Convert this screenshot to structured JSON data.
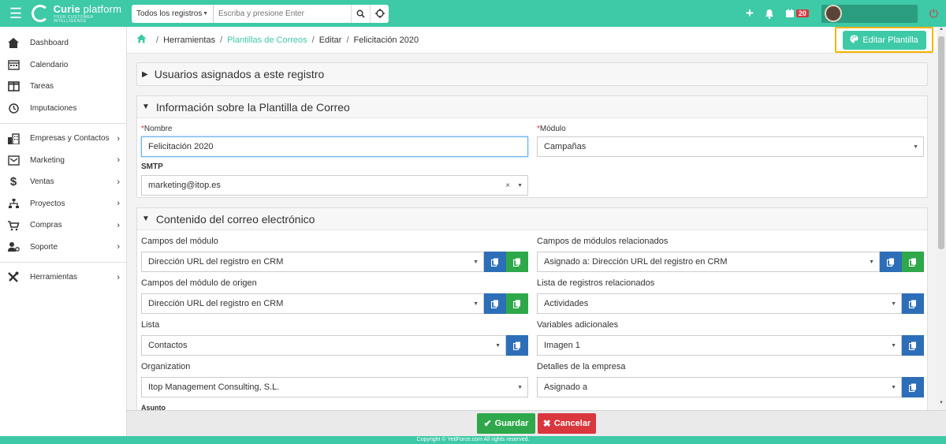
{
  "topbar": {
    "brand_name": "Curie",
    "brand_suffix": "platform",
    "brand_tagline": "YOUR CUSTOMER INTELLIGENCE",
    "search_scope": "Todos los registros",
    "search_placeholder": "Escriba y presione Enter",
    "calendar_badge": "20"
  },
  "sidebar": {
    "items": [
      {
        "label": "Dashboard"
      },
      {
        "label": "Calendario"
      },
      {
        "label": "Tareas"
      },
      {
        "label": "Imputaciones"
      },
      {
        "label": "Empresas y Contactos"
      },
      {
        "label": "Marketing"
      },
      {
        "label": "Ventas"
      },
      {
        "label": "Proyectos"
      },
      {
        "label": "Compras"
      },
      {
        "label": "Soporte"
      },
      {
        "label": "Herramientas"
      }
    ]
  },
  "breadcrumb": {
    "items": [
      "Herramientas",
      "Plantillas de Correos",
      "Editar",
      "Felicitación 2020"
    ]
  },
  "edit_template_label": "Editar Plantilla",
  "panels": {
    "users": {
      "title": "Usuarios asignados a este registro"
    },
    "info": {
      "title": "Información sobre la Plantilla de Correo",
      "name_label": "Nombre",
      "name_value": "Felicitación 2020",
      "module_label": "Módulo",
      "module_value": "Campañas",
      "smtp_label": "SMTP",
      "smtp_value": "marketing@itop.es"
    },
    "content": {
      "title": "Contenido del correo electrónico",
      "fields": {
        "module_fields_label": "Campos del módulo",
        "module_fields_value": "Dirección URL del registro en CRM",
        "related_module_fields_label": "Campos de módulos relacionados",
        "related_module_fields_value": "Asignado a: Dirección URL del registro en CRM",
        "source_module_fields_label": "Campos del módulo de origen",
        "source_module_fields_value": "Dirección URL del registro en CRM",
        "related_records_label": "Lista de registros relacionados",
        "related_records_value": "Actividades",
        "list_label": "Lista",
        "list_value": "Contactos",
        "extra_vars_label": "Variables adicionales",
        "extra_vars_value": "Imagen 1",
        "organization_label": "Organization",
        "organization_value": "Itop Management Consulting, S.L.",
        "company_details_label": "Detalles de la empresa",
        "company_details_value": "Asignado a",
        "subject_label": "Asunto"
      }
    }
  },
  "actions": {
    "save": "Guardar",
    "cancel": "Cancelar"
  },
  "footer": {
    "copyright": "Copyright © YetiForce.com All rights reserved."
  }
}
